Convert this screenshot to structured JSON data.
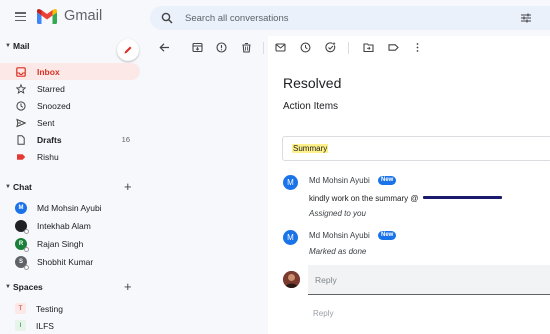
{
  "app": {
    "name": "Gmail",
    "search_placeholder": "Search all conversations"
  },
  "sidebar": {
    "mail": {
      "label": "Mail",
      "items": [
        {
          "label": "Inbox",
          "icon": "inbox-icon",
          "active": true,
          "count": ""
        },
        {
          "label": "Starred",
          "icon": "star-icon",
          "active": false,
          "count": ""
        },
        {
          "label": "Snoozed",
          "icon": "clock-icon",
          "active": false,
          "count": ""
        },
        {
          "label": "Sent",
          "icon": "send-icon",
          "active": false,
          "count": ""
        },
        {
          "label": "Drafts",
          "icon": "draft-icon",
          "active": false,
          "count": "16"
        },
        {
          "label": "Rishu",
          "icon": "label-icon",
          "active": false,
          "count": ""
        }
      ]
    },
    "chat": {
      "label": "Chat",
      "contacts": [
        {
          "name": "Md Mohsin Ayubi",
          "initial": "M",
          "color": "#1a73e8"
        },
        {
          "name": "Intekhab Alam",
          "initial": "",
          "color": "#202124"
        },
        {
          "name": "Rajan Singh",
          "initial": "R",
          "color": "#188038"
        },
        {
          "name": "Shobhit Kumar",
          "initial": "S",
          "color": "#5f6368"
        }
      ]
    },
    "spaces": {
      "label": "Spaces",
      "items": [
        {
          "name": "Testing",
          "initial": "T",
          "color": "#fce8e6",
          "text_color": "#d93025"
        },
        {
          "name": "ILFS",
          "initial": "I",
          "color": "#e6f4ea",
          "text_color": "#188038"
        }
      ]
    }
  },
  "thread": {
    "title": "Resolved",
    "subtitle": "Action Items",
    "summary": "Summary",
    "messages": [
      {
        "author": "Md Mohsin Ayubi",
        "badge": "New",
        "text": "kindly work on the summary @",
        "status": "Assigned to you"
      },
      {
        "author": "Md Mohsin Ayubi",
        "badge": "New",
        "text": "",
        "status": "Marked as done"
      }
    ],
    "reply_placeholder": "Reply",
    "reply_hint": "Reply"
  },
  "colors": {
    "accent_red": "#d93025",
    "accent_blue": "#1a73e8",
    "active_bg": "#fce8e6"
  }
}
